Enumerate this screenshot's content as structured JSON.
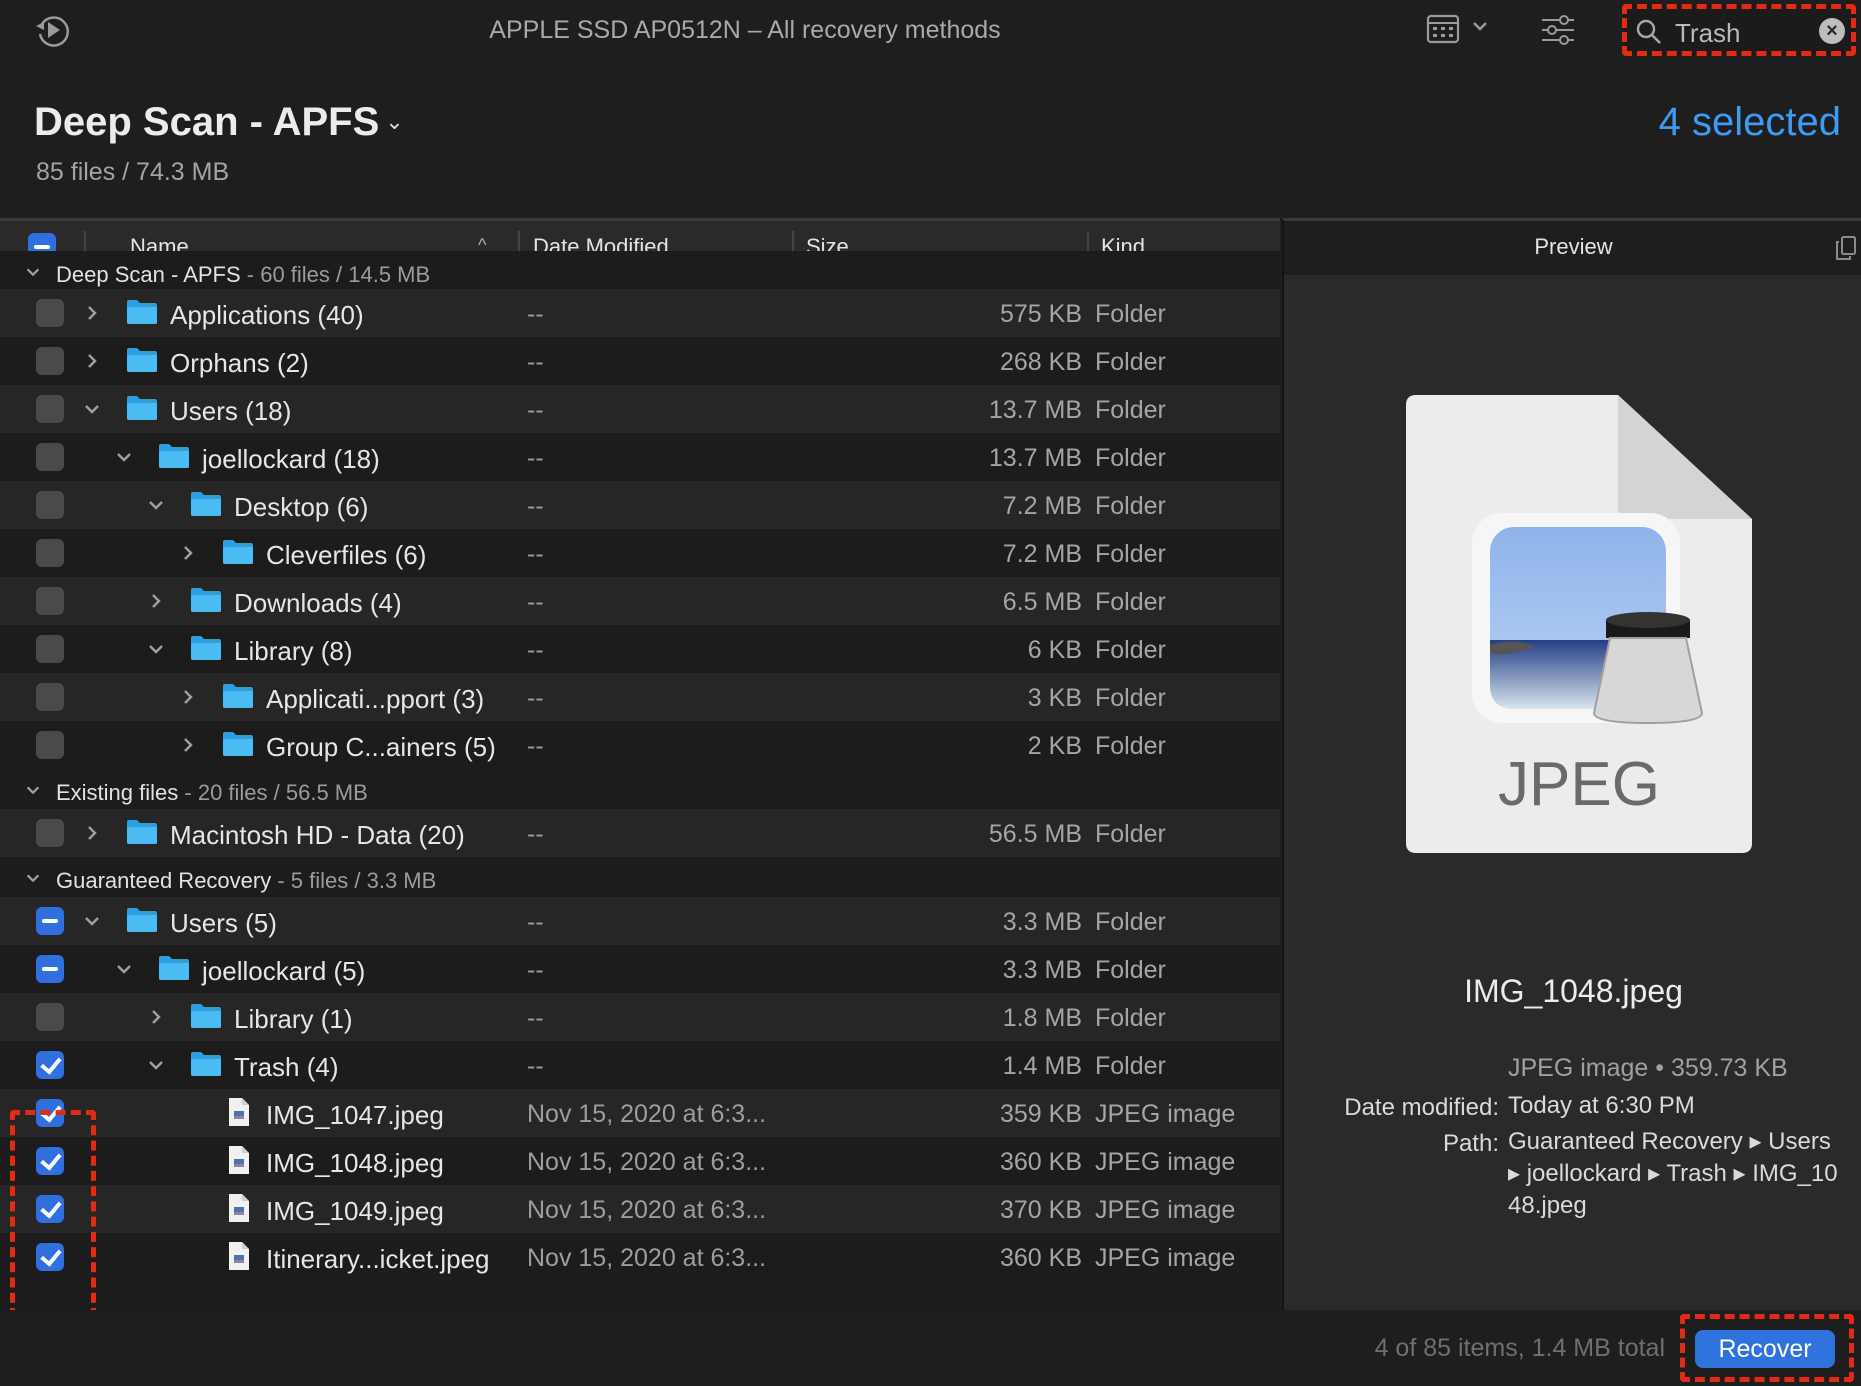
{
  "window": {
    "title": "APPLE SSD AP0512N – All recovery methods"
  },
  "toolbar": {
    "restore_icon": "restore-session-icon",
    "view_icon": "grid-view-icon",
    "filter_icon": "filter-sliders-icon",
    "search": {
      "value": "Trash",
      "placeholder": "Search",
      "clear_icon": "clear-icon"
    }
  },
  "header": {
    "scan_title": "Deep Scan - APFS",
    "scan_summary": "85 files / 74.3 MB",
    "selected": "4 selected"
  },
  "columns": {
    "name": "Name",
    "date": "Date Modified",
    "size": "Size",
    "kind": "Kind"
  },
  "groups": [
    {
      "label": "Deep Scan - APFS",
      "meta": " - 60 files / 14.5 MB"
    },
    {
      "label": "Existing files",
      "meta": " - 20 files / 56.5 MB"
    },
    {
      "label": "Guaranteed Recovery",
      "meta": " - 5 files / 3.3 MB"
    }
  ],
  "rows": [
    {
      "name": "Applications (40)",
      "date": "--",
      "size": "575 KB",
      "kind": "Folder",
      "level": 0,
      "expanded": false,
      "check": "off",
      "type": "folder"
    },
    {
      "name": "Orphans (2)",
      "date": "--",
      "size": "268 KB",
      "kind": "Folder",
      "level": 0,
      "expanded": false,
      "check": "off",
      "type": "folder"
    },
    {
      "name": "Users (18)",
      "date": "--",
      "size": "13.7 MB",
      "kind": "Folder",
      "level": 0,
      "expanded": true,
      "check": "off",
      "type": "folder"
    },
    {
      "name": "joellockard (18)",
      "date": "--",
      "size": "13.7 MB",
      "kind": "Folder",
      "level": 1,
      "expanded": true,
      "check": "off",
      "type": "folder"
    },
    {
      "name": "Desktop (6)",
      "date": "--",
      "size": "7.2 MB",
      "kind": "Folder",
      "level": 2,
      "expanded": true,
      "check": "off",
      "type": "folder"
    },
    {
      "name": "Cleverfiles (6)",
      "date": "--",
      "size": "7.2 MB",
      "kind": "Folder",
      "level": 3,
      "expanded": false,
      "check": "off",
      "type": "folder"
    },
    {
      "name": "Downloads (4)",
      "date": "--",
      "size": "6.5 MB",
      "kind": "Folder",
      "level": 2,
      "expanded": false,
      "check": "off",
      "type": "folder"
    },
    {
      "name": "Library (8)",
      "date": "--",
      "size": "6 KB",
      "kind": "Folder",
      "level": 2,
      "expanded": true,
      "check": "off",
      "type": "folder"
    },
    {
      "name": "Applicati...pport (3)",
      "date": "--",
      "size": "3 KB",
      "kind": "Folder",
      "level": 3,
      "expanded": false,
      "check": "off",
      "type": "folder"
    },
    {
      "name": "Group C...ainers (5)",
      "date": "--",
      "size": "2 KB",
      "kind": "Folder",
      "level": 3,
      "expanded": false,
      "check": "off",
      "type": "folder"
    },
    {
      "name": "Macintosh HD - Data (20)",
      "date": "--",
      "size": "56.5 MB",
      "kind": "Folder",
      "level": 0,
      "expanded": false,
      "check": "off",
      "type": "folder"
    },
    {
      "name": "Users (5)",
      "date": "--",
      "size": "3.3 MB",
      "kind": "Folder",
      "level": 0,
      "expanded": true,
      "check": "mixed",
      "type": "folder"
    },
    {
      "name": "joellockard (5)",
      "date": "--",
      "size": "3.3 MB",
      "kind": "Folder",
      "level": 1,
      "expanded": true,
      "check": "mixed",
      "type": "folder"
    },
    {
      "name": "Library (1)",
      "date": "--",
      "size": "1.8 MB",
      "kind": "Folder",
      "level": 2,
      "expanded": false,
      "check": "off",
      "type": "folder"
    },
    {
      "name": "Trash (4)",
      "date": "--",
      "size": "1.4 MB",
      "kind": "Folder",
      "level": 2,
      "expanded": true,
      "check": "on",
      "type": "folder"
    },
    {
      "name": "IMG_1047.jpeg",
      "date": "Nov 15, 2020 at 6:3...",
      "size": "359 KB",
      "kind": "JPEG image",
      "level": 3,
      "check": "on",
      "type": "file"
    },
    {
      "name": "IMG_1048.jpeg",
      "date": "Nov 15, 2020 at 6:3...",
      "size": "360 KB",
      "kind": "JPEG image",
      "level": 3,
      "check": "on",
      "type": "file"
    },
    {
      "name": "IMG_1049.jpeg",
      "date": "Nov 15, 2020 at 6:3...",
      "size": "370 KB",
      "kind": "JPEG image",
      "level": 3,
      "check": "on",
      "type": "file"
    },
    {
      "name": "Itinerary...icket.jpeg",
      "date": "Nov 15, 2020 at 6:3...",
      "size": "360 KB",
      "kind": "JPEG image",
      "level": 3,
      "check": "on",
      "type": "file"
    }
  ],
  "preview": {
    "title": "Preview",
    "icon_label": "JPEG",
    "file_name": "IMG_1048.jpeg",
    "type_size": "JPEG image • 359.73 KB",
    "date_label": "Date modified:",
    "date_value": "Today at 6:30 PM",
    "path_label": "Path:",
    "path_value": "Guaranteed Recovery ▸ Users ▸ joellockard ▸ Trash ▸ IMG_1048.jpeg"
  },
  "footer": {
    "status": "4 of 85 items, 1.4 MB total",
    "recover_label": "Recover"
  },
  "colors": {
    "accent": "#2f72dc",
    "selected_text": "#3e9bf2",
    "annotation": "#e32a12",
    "folder": "#3cb2f0"
  }
}
